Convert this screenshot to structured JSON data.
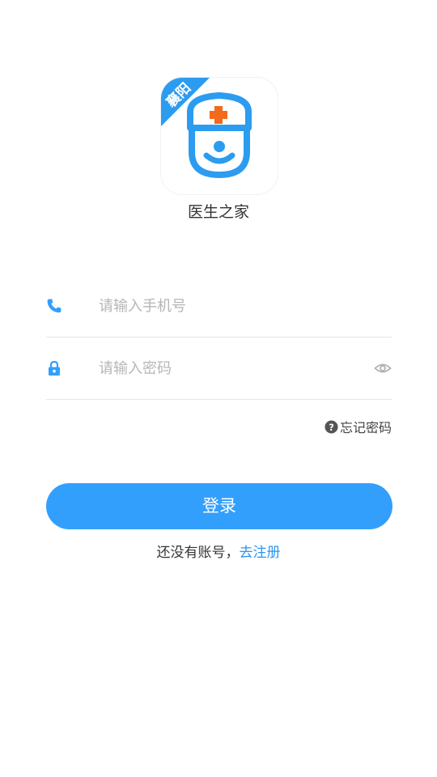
{
  "app": {
    "name": "医生之家",
    "logo_badge_text": "襄阳",
    "logo_icon": "doctor-cap-face-icon"
  },
  "form": {
    "phone": {
      "icon": "phone-icon",
      "placeholder": "请输入手机号",
      "value": ""
    },
    "password": {
      "icon": "lock-icon",
      "placeholder": "请输入密码",
      "value": "",
      "toggle_icon": "eye-icon"
    },
    "forgot": {
      "icon": "question-circle-icon",
      "label": "忘记密码"
    },
    "login_label": "登录",
    "register_prompt": "还没有账号，",
    "register_link": "去注册"
  },
  "colors": {
    "primary": "#339ffc",
    "logo_blue": "#2c9cf0",
    "logo_cross": "#f26a1b",
    "text": "#333333",
    "placeholder": "#b6b6b6",
    "divider": "#e6e6e6"
  }
}
